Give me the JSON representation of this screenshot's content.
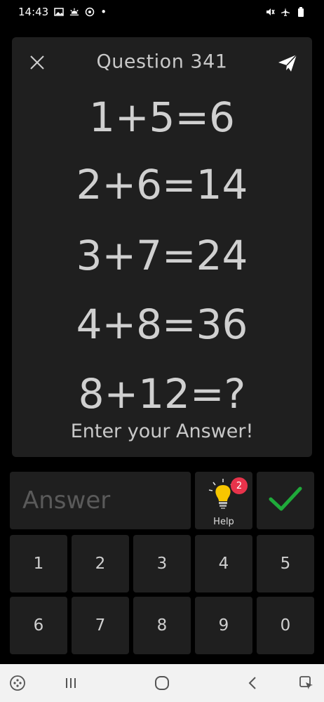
{
  "status_bar": {
    "time": "14:43",
    "dot": "•",
    "left_icons": [
      "image-icon",
      "weather-icon",
      "sync-icon"
    ],
    "right_icons": [
      "mute-icon",
      "airplane-icon",
      "battery-icon"
    ]
  },
  "question": {
    "title": "Question 341",
    "equations": [
      "1+5=6",
      "2+6=14",
      "3+7=24",
      "4+8=36",
      "8+12=?"
    ],
    "prompt": "Enter your Answer!"
  },
  "answer": {
    "placeholder": "Answer",
    "value": ""
  },
  "help": {
    "label": "Help",
    "badge_count": "2"
  },
  "keypad": {
    "keys": [
      "1",
      "2",
      "3",
      "4",
      "5",
      "6",
      "7",
      "8",
      "9",
      "0"
    ]
  },
  "colors": {
    "background": "#000000",
    "card": "#1f1f1f",
    "accent_check": "#1faa3a",
    "badge": "#e8334b",
    "bulb": "#f7c600"
  },
  "nav_bar": {
    "icons": [
      "game-launcher-icon",
      "recents-icon",
      "home-icon",
      "back-icon",
      "screen-capture-icon"
    ]
  }
}
